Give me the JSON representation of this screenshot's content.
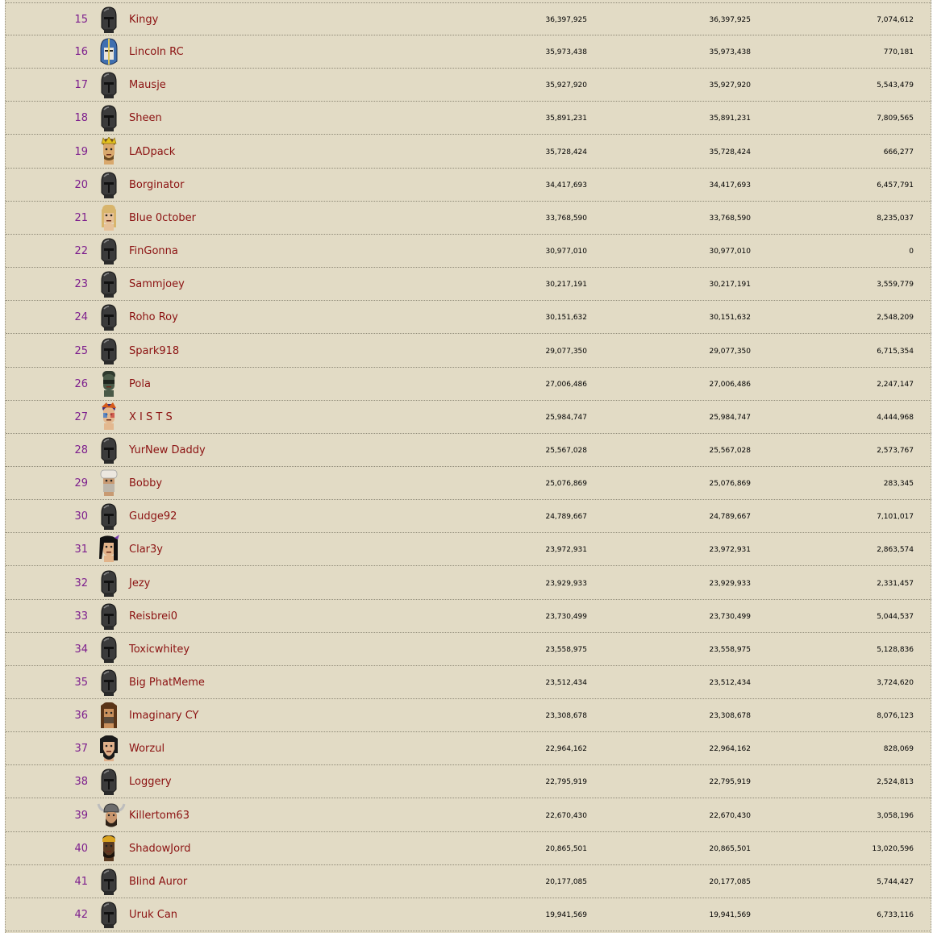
{
  "colors": {
    "background": "#e2dbc5",
    "rank": "#7d1e8d",
    "name_link": "#8b1111",
    "value": "#000000",
    "divider": "#8f8a78"
  },
  "rows": [
    {
      "rank": "15",
      "name": "Kingy",
      "v1": "36,397,925",
      "v2": "36,397,925",
      "v3": "7,074,612",
      "avatar": "helmet-icon"
    },
    {
      "rank": "16",
      "name": "Lincoln RC",
      "v1": "35,973,438",
      "v2": "35,973,438",
      "v3": "770,181",
      "avatar": "blue-helmet-icon"
    },
    {
      "rank": "17",
      "name": "Mausje",
      "v1": "35,927,920",
      "v2": "35,927,920",
      "v3": "5,543,479",
      "avatar": "helmet-icon"
    },
    {
      "rank": "18",
      "name": "Sheen",
      "v1": "35,891,231",
      "v2": "35,891,231",
      "v3": "7,809,565",
      "avatar": "helmet-icon"
    },
    {
      "rank": "19",
      "name": "LADpack",
      "v1": "35,728,424",
      "v2": "35,728,424",
      "v3": "666,277",
      "avatar": "crowned-head-icon"
    },
    {
      "rank": "20",
      "name": "Borginator",
      "v1": "34,417,693",
      "v2": "34,417,693",
      "v3": "6,457,791",
      "avatar": "helmet-icon"
    },
    {
      "rank": "21",
      "name": "Blue 0ctober",
      "v1": "33,768,590",
      "v2": "33,768,590",
      "v3": "8,235,037",
      "avatar": "blonde-head-icon"
    },
    {
      "rank": "22",
      "name": "FinGonna",
      "v1": "30,977,010",
      "v2": "30,977,010",
      "v3": "0",
      "avatar": "helmet-icon"
    },
    {
      "rank": "23",
      "name": "Sammjoey",
      "v1": "30,217,191",
      "v2": "30,217,191",
      "v3": "3,559,779",
      "avatar": "helmet-icon"
    },
    {
      "rank": "24",
      "name": "Roho Roy",
      "v1": "30,151,632",
      "v2": "30,151,632",
      "v3": "2,548,209",
      "avatar": "helmet-icon"
    },
    {
      "rank": "25",
      "name": "Spark918",
      "v1": "29,077,350",
      "v2": "29,077,350",
      "v3": "6,715,354",
      "avatar": "helmet-icon"
    },
    {
      "rank": "26",
      "name": "Pola",
      "v1": "27,006,486",
      "v2": "27,006,486",
      "v3": "2,247,147",
      "avatar": "masked-head-icon"
    },
    {
      "rank": "27",
      "name": "X I S T S",
      "v1": "25,984,747",
      "v2": "25,984,747",
      "v3": "4,444,968",
      "avatar": "painted-head-icon"
    },
    {
      "rank": "28",
      "name": "YurNew Daddy",
      "v1": "25,567,028",
      "v2": "25,567,028",
      "v3": "2,573,767",
      "avatar": "helmet-icon"
    },
    {
      "rank": "29",
      "name": "Bobby",
      "v1": "25,076,869",
      "v2": "25,076,869",
      "v3": "283,345",
      "avatar": "turban-head-icon"
    },
    {
      "rank": "30",
      "name": "Gudge92",
      "v1": "24,789,667",
      "v2": "24,789,667",
      "v3": "7,101,017",
      "avatar": "helmet-icon"
    },
    {
      "rank": "31",
      "name": "Clar3y",
      "v1": "23,972,931",
      "v2": "23,972,931",
      "v3": "2,863,574",
      "avatar": "dark-hair-head-icon"
    },
    {
      "rank": "32",
      "name": "Jezy",
      "v1": "23,929,933",
      "v2": "23,929,933",
      "v3": "2,331,457",
      "avatar": "helmet-icon"
    },
    {
      "rank": "33",
      "name": "Reisbrei0",
      "v1": "23,730,499",
      "v2": "23,730,499",
      "v3": "5,044,537",
      "avatar": "helmet-icon"
    },
    {
      "rank": "34",
      "name": "Toxicwhitey",
      "v1": "23,558,975",
      "v2": "23,558,975",
      "v3": "5,128,836",
      "avatar": "helmet-icon"
    },
    {
      "rank": "35",
      "name": "Big PhatMeme",
      "v1": "23,512,434",
      "v2": "23,512,434",
      "v3": "3,724,620",
      "avatar": "helmet-icon"
    },
    {
      "rank": "36",
      "name": "Imaginary CY",
      "v1": "23,308,678",
      "v2": "23,308,678",
      "v3": "8,076,123",
      "avatar": "long-hair-head-icon"
    },
    {
      "rank": "37",
      "name": "Worzul",
      "v1": "22,964,162",
      "v2": "22,964,162",
      "v3": "828,069",
      "avatar": "bearded-head-icon"
    },
    {
      "rank": "38",
      "name": "Loggery",
      "v1": "22,795,919",
      "v2": "22,795,919",
      "v3": "2,524,813",
      "avatar": "helmet-icon"
    },
    {
      "rank": "39",
      "name": "Killertom63",
      "v1": "22,670,430",
      "v2": "22,670,430",
      "v3": "3,058,196",
      "avatar": "horned-helmet-icon"
    },
    {
      "rank": "40",
      "name": "ShadowJord",
      "v1": "20,865,501",
      "v2": "20,865,501",
      "v3": "13,020,596",
      "avatar": "dark-skin-head-icon"
    },
    {
      "rank": "41",
      "name": "Blind Auror",
      "v1": "20,177,085",
      "v2": "20,177,085",
      "v3": "5,744,427",
      "avatar": "helmet-icon"
    },
    {
      "rank": "42",
      "name": "Uruk Can",
      "v1": "19,941,569",
      "v2": "19,941,569",
      "v3": "6,733,116",
      "avatar": "helmet-icon"
    }
  ]
}
